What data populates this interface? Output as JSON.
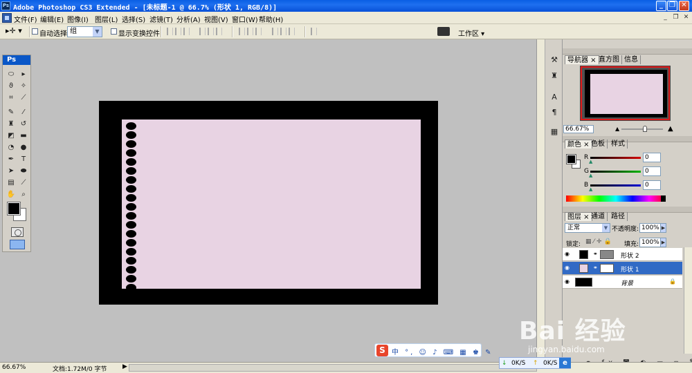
{
  "titlebar": {
    "title": "Adobe Photoshop CS3 Extended - [未标题-1 @ 66.7% (形状 1, RGB/8)]",
    "logo": "Ps",
    "minimize_glyph": "_",
    "restore_glyph": "❐",
    "close_glyph": "✕"
  },
  "menubar": {
    "items": [
      "文件(F)",
      "编辑(E)",
      "图像(I)",
      "图层(L)",
      "选择(S)",
      "滤镜(T)",
      "分析(A)",
      "视图(V)",
      "窗口(W)",
      "帮助(H)"
    ],
    "mdi_min": "_",
    "mdi_restore": "❐",
    "mdi_close": "✕"
  },
  "optionsbar": {
    "tool_icon": "move-tool-icon",
    "tool_glyph": "▸✛ ▾",
    "auto_select_label": "自动选择:",
    "auto_select_value": "组",
    "show_transform_label": "显示变换控件",
    "workspace_label": "工作区 ▾"
  },
  "toolbox": {
    "header": "Ps",
    "tools": [
      {
        "name": "marquee-tool-icon",
        "glyph": "⬭"
      },
      {
        "name": "move-tool-icon",
        "glyph": "▸"
      },
      {
        "name": "lasso-tool-icon",
        "glyph": "ϑ"
      },
      {
        "name": "magic-wand-tool-icon",
        "glyph": "✧"
      },
      {
        "name": "crop-tool-icon",
        "glyph": "⌗"
      },
      {
        "name": "slice-tool-icon",
        "glyph": "⟋"
      },
      {
        "name": "healing-brush-tool-icon",
        "glyph": "✎"
      },
      {
        "name": "brush-tool-icon",
        "glyph": "⁄"
      },
      {
        "name": "clone-stamp-tool-icon",
        "glyph": "♜"
      },
      {
        "name": "history-brush-tool-icon",
        "glyph": "↺"
      },
      {
        "name": "eraser-tool-icon",
        "glyph": "◩"
      },
      {
        "name": "gradient-tool-icon",
        "glyph": "▬"
      },
      {
        "name": "blur-tool-icon",
        "glyph": "◔"
      },
      {
        "name": "dodge-tool-icon",
        "glyph": "●"
      },
      {
        "name": "pen-tool-icon",
        "glyph": "✒"
      },
      {
        "name": "type-tool-icon",
        "glyph": "T"
      },
      {
        "name": "path-selection-tool-icon",
        "glyph": "➤"
      },
      {
        "name": "shape-tool-icon",
        "glyph": "⬬"
      },
      {
        "name": "notes-tool-icon",
        "glyph": "▤"
      },
      {
        "name": "eyedropper-tool-icon",
        "glyph": "⟋"
      },
      {
        "name": "hand-tool-icon",
        "glyph": "✋"
      },
      {
        "name": "zoom-tool-icon",
        "glyph": "⌕"
      }
    ]
  },
  "dock": {
    "icons": [
      {
        "name": "brushes-dock-icon",
        "glyph": "⚒"
      },
      {
        "name": "clone-source-dock-icon",
        "glyph": "♜"
      },
      {
        "name": "character-dock-icon",
        "glyph": "A"
      },
      {
        "name": "paragraph-dock-icon",
        "glyph": "¶"
      },
      {
        "name": "layer-comps-dock-icon",
        "glyph": "▦"
      }
    ]
  },
  "navigator": {
    "tabs": [
      "导航器 ×",
      "直方图",
      "信息"
    ],
    "zoom": "66.67%"
  },
  "color": {
    "tabs": [
      "颜色 ×",
      "色板",
      "样式"
    ],
    "channels": [
      {
        "label": "R",
        "value": "0",
        "color": "#d40000"
      },
      {
        "label": "G",
        "value": "0",
        "color": "#00b400"
      },
      {
        "label": "B",
        "value": "0",
        "color": "#0000d4"
      }
    ]
  },
  "layers": {
    "tabs": [
      "图层 ×",
      "通道",
      "路径"
    ],
    "blend_mode": "正常",
    "opacity_label": "不透明度:",
    "opacity": "100%",
    "lock_label": "锁定:",
    "fill_label": "填充:",
    "fill": "100%",
    "items": [
      {
        "name": "形状 2",
        "thumb_color": "#000000",
        "selected": false
      },
      {
        "name": "形状 1",
        "thumb_color": "#e8d3e3",
        "selected": true
      },
      {
        "name": "背景",
        "thumb_color": "#000000",
        "selected": false
      }
    ],
    "footer_glyphs": "⚭ fx ◙ ◐ ▭ ▫ 🗑"
  },
  "statusbar": {
    "zoom": "66.67%",
    "doc_info": "文档:1.72M/0 字节",
    "arrow": "▶",
    "net_down": "0K/S",
    "net_up": "0K/S"
  },
  "ime": {
    "logo": "S",
    "items": "中 °, ☺ ♪ ⌨ ▦ ♚ ✎"
  },
  "watermark": {
    "main": "Bai 经验",
    "url": "jingyan.baidu.com"
  },
  "colors": {
    "canvas_bg": "#c0c0c0",
    "doc_border": "#000000",
    "paper": "#e8d3e3",
    "accent": "#316ac5"
  }
}
